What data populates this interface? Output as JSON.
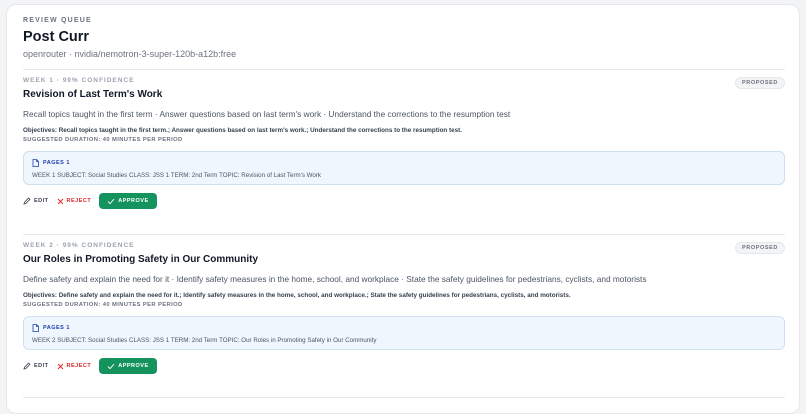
{
  "header": {
    "queue_label": "REVIEW QUEUE",
    "title": "Post Curr",
    "subtitle": "openrouter · nvidia/nemotron-3-super-120b-a12b:free"
  },
  "weeks": [
    {
      "meta": "WEEK 1 · 99% CONFIDENCE",
      "badge": "PROPOSED",
      "title": "Revision of Last Term's Work",
      "summary": "Recall topics taught in the first term · Answer questions based on last term's work · Understand the corrections to the resumption test",
      "objectives": "Objectives: Recall topics taught in the first term.; Answer questions based on last term's work.; Understand the corrections to the resumption test.",
      "duration": "SUGGESTED DURATION: 40 MINUTES PER PERIOD",
      "pages_label": "PAGES 1",
      "pages_line": "WEEK 1 SUBJECT: Social Studies CLASS: JSS 1 TERM: 2nd Term TOPIC: Revision of Last Term's Work",
      "edit": "EDIT",
      "reject": "REJECT",
      "approve": "APPROVE"
    },
    {
      "meta": "WEEK 2 · 99% CONFIDENCE",
      "badge": "PROPOSED",
      "title": "Our Roles in Promoting Safety in Our Community",
      "summary": "Define safety and explain the need for it · Identify safety measures in the home, school, and workplace · State the safety guidelines for pedestrians, cyclists, and motorists",
      "objectives": "Objectives: Define safety and explain the need for it.; Identify safety measures in the home, school, and workplace.; State the safety guidelines for pedestrians, cyclists, and motorists.",
      "duration": "SUGGESTED DURATION: 40 MINUTES PER PERIOD",
      "pages_label": "PAGES 1",
      "pages_line": "WEEK 2 SUBJECT: Social Studies CLASS: JSS 1 TERM: 2nd Term TOPIC: Our Roles in Promoting Safety in Our Community",
      "edit": "EDIT",
      "reject": "REJECT",
      "approve": "APPROVE"
    }
  ],
  "colors": {
    "approve": "#15935f",
    "reject": "#dc2626",
    "pages_bg": "#f0f6fd"
  }
}
